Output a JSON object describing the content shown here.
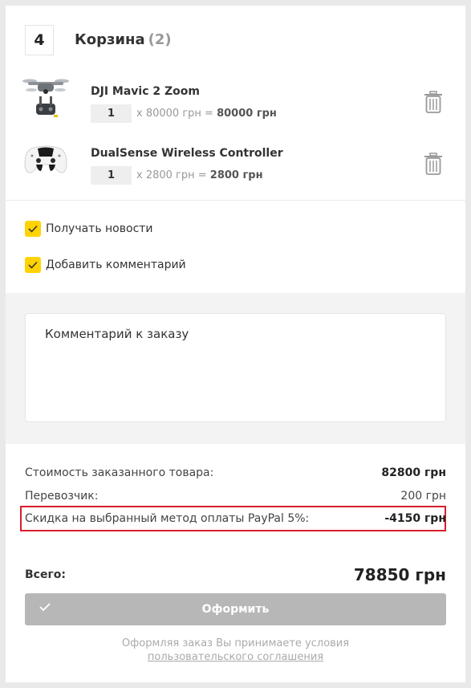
{
  "step": {
    "number": "4"
  },
  "cart": {
    "title": "Корзина",
    "count": "(2)",
    "items": [
      {
        "name": "DJI Mavic 2 Zoom",
        "quantity": "1",
        "price_text": "x 80000 грн = ",
        "total_text": "80000 грн"
      },
      {
        "name": "DualSense Wireless Controller",
        "quantity": "1",
        "price_text": "x 2800 грн = ",
        "total_text": "2800 грн"
      }
    ]
  },
  "options": {
    "news_label": "Получать новости",
    "news_checked": true,
    "comment_label": "Добавить комментарий",
    "comment_checked": true
  },
  "comment": {
    "placeholder": "Комментарий к заказу"
  },
  "summary": {
    "goods_label": "Стоимость заказанного товара:",
    "goods_value": "82800 грн",
    "carrier_label": "Перевозчик:",
    "carrier_value": "200 грн",
    "discount_label": "Скидка на выбранный метод оплаты PayPal 5%:",
    "discount_value": "-4150 грн",
    "total_label": "Всего:",
    "total_value": "78850 грн"
  },
  "submit": {
    "label": "Оформить"
  },
  "terms": {
    "text": "Оформляя заказ Вы принимаете условия",
    "link": "пользовательского соглашения"
  },
  "colors": {
    "accent": "#ffd200",
    "button": "#b7b7b7",
    "highlight": "#d81e2c"
  }
}
